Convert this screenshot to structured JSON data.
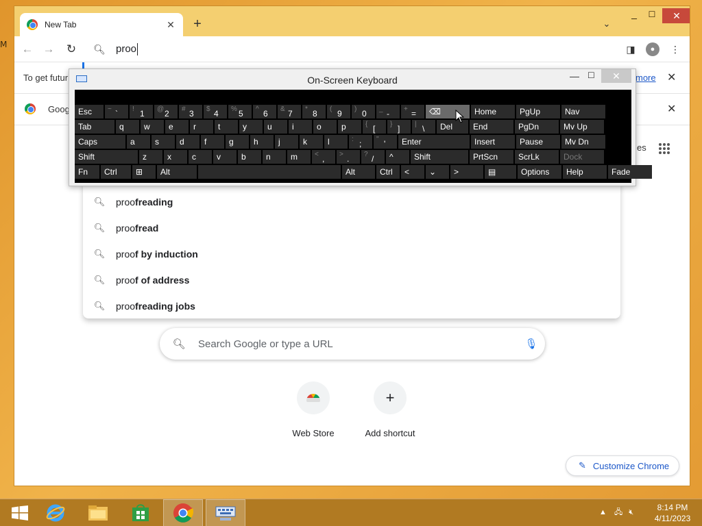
{
  "browser": {
    "tab_title": "New Tab",
    "omnibox_text": "proo",
    "infobar1_text": "To get futur",
    "infobar1_link": "more",
    "infobar2_text": "Goog",
    "partial_right_text": "es"
  },
  "suggestions": [
    {
      "prefix": "proo",
      "rest": "freading"
    },
    {
      "prefix": "proo",
      "rest": "fread"
    },
    {
      "prefix": "proo",
      "rest": "f by induction"
    },
    {
      "prefix": "proo",
      "rest": "f of address"
    },
    {
      "prefix": "proo",
      "rest": "freading jobs"
    }
  ],
  "ntp": {
    "search_placeholder": "Search Google or type a URL",
    "shortcuts": [
      {
        "label": "Web Store"
      },
      {
        "label": "Add shortcut"
      }
    ],
    "customize_label": "Customize Chrome"
  },
  "osk": {
    "title": "On-Screen Keyboard",
    "rows": [
      [
        {
          "l": "Esc"
        },
        {
          "s": "~",
          "m": "`"
        },
        {
          "s": "!",
          "m": "1"
        },
        {
          "s": "@",
          "m": "2"
        },
        {
          "s": "#",
          "m": "3"
        },
        {
          "s": "$",
          "m": "4"
        },
        {
          "s": "%",
          "m": "5"
        },
        {
          "s": "^",
          "m": "6"
        },
        {
          "s": "&",
          "m": "7"
        },
        {
          "s": "*",
          "m": "8"
        },
        {
          "s": "(",
          "m": "9"
        },
        {
          "s": ")",
          "m": "0"
        },
        {
          "s": "_",
          "m": "-"
        },
        {
          "s": "+",
          "m": "="
        },
        {
          "l": "⌫",
          "bk": true
        },
        {
          "l": "Home"
        },
        {
          "l": "PgUp"
        },
        {
          "l": "Nav"
        }
      ],
      [
        {
          "l": "Tab"
        },
        {
          "l": "q"
        },
        {
          "l": "w"
        },
        {
          "l": "e"
        },
        {
          "l": "r"
        },
        {
          "l": "t"
        },
        {
          "l": "y"
        },
        {
          "l": "u"
        },
        {
          "l": "i"
        },
        {
          "l": "o"
        },
        {
          "l": "p"
        },
        {
          "s": "{",
          "m": "["
        },
        {
          "s": "}",
          "m": "]"
        },
        {
          "s": "|",
          "m": "\\"
        },
        {
          "l": "Del"
        },
        {
          "l": "End"
        },
        {
          "l": "PgDn"
        },
        {
          "l": "Mv Up"
        }
      ],
      [
        {
          "l": "Caps"
        },
        {
          "l": "a"
        },
        {
          "l": "s"
        },
        {
          "l": "d"
        },
        {
          "l": "f"
        },
        {
          "l": "g"
        },
        {
          "l": "h"
        },
        {
          "l": "j"
        },
        {
          "l": "k"
        },
        {
          "l": "l"
        },
        {
          "s": ":",
          "m": ";"
        },
        {
          "s": "\"",
          "m": "'"
        },
        {
          "l": "Enter"
        },
        {
          "l": "Insert"
        },
        {
          "l": "Pause"
        },
        {
          "l": "Mv Dn"
        }
      ],
      [
        {
          "l": "Shift"
        },
        {
          "l": "z"
        },
        {
          "l": "x"
        },
        {
          "l": "c"
        },
        {
          "l": "v"
        },
        {
          "l": "b"
        },
        {
          "l": "n"
        },
        {
          "l": "m"
        },
        {
          "s": "<",
          "m": ","
        },
        {
          "s": ">",
          "m": "."
        },
        {
          "s": "?",
          "m": "/"
        },
        {
          "l": "^"
        },
        {
          "l": "Shift"
        },
        {
          "l": "PrtScn"
        },
        {
          "l": "ScrLk"
        },
        {
          "l": "Dock",
          "dis": true
        }
      ],
      [
        {
          "l": "Fn"
        },
        {
          "l": "Ctrl"
        },
        {
          "l": "⊞"
        },
        {
          "l": "Alt"
        },
        {
          "l": ""
        },
        {
          "l": "Alt"
        },
        {
          "l": "Ctrl"
        },
        {
          "l": "<"
        },
        {
          "l": "⌄"
        },
        {
          "l": ">"
        },
        {
          "l": "▤"
        },
        {
          "l": "Options"
        },
        {
          "l": "Help"
        },
        {
          "l": "Fade"
        }
      ]
    ]
  },
  "clock": {
    "time": "8:14 PM",
    "date": "4/11/2023"
  },
  "colors": {
    "accent": "#1a73e8",
    "taskbar": "#b17a22",
    "osk_key": "#2b2b2b"
  }
}
